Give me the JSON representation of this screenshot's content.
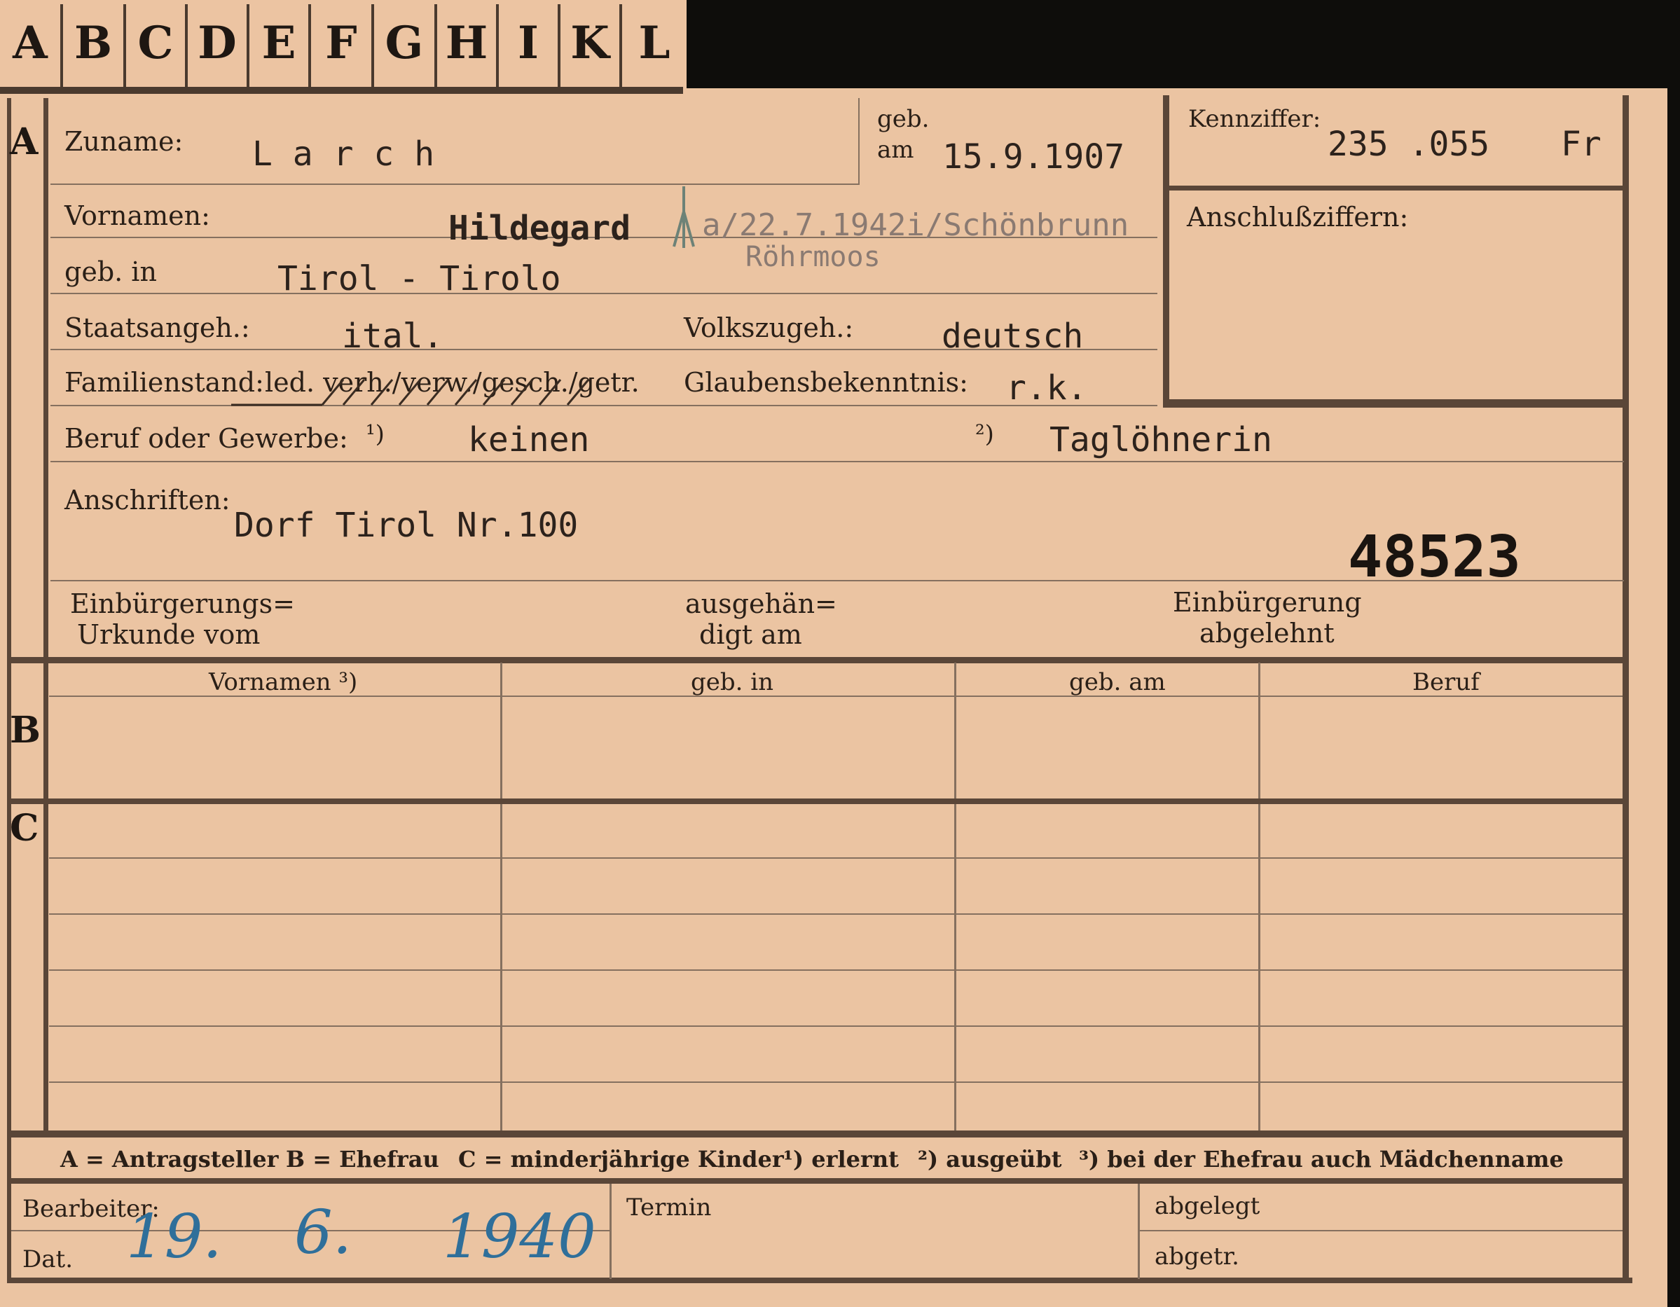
{
  "tabs": [
    "A",
    "B",
    "C",
    "D",
    "E",
    "F",
    "G",
    "H",
    "I",
    "K",
    "L"
  ],
  "sections": {
    "a": "A",
    "b": "B",
    "c": "C"
  },
  "fields": {
    "zuname_label": "Zuname:",
    "zuname_value": "L a r c h",
    "geb_label": "geb.",
    "am_label": "am",
    "geb_am_value": "15.9.1907",
    "kennziffer_label": "Kennziffer:",
    "kennziffer_value": "235 .055",
    "kennziffer_suffix": "Fr",
    "anschluss_label": "Anschlußziffern:",
    "vornamen_label": "Vornamen:",
    "vornamen_value": "Hildegard",
    "vornamen_note": "a/22.7.1942i/Schönbrunn",
    "vornamen_note2": "Röhrmoos",
    "geb_in_label": "geb. in",
    "geb_in_value": "Tirol - Tirolo",
    "staatsangeh_label": "Staatsangeh.:",
    "staatsangeh_value": "ital.",
    "volkszugeh_label": "Volkszugeh.:",
    "volkszugeh_value": "deutsch",
    "familienstand_label": "Familienstand:",
    "familienstand_options": "led. verh./verw./gesch./getr.",
    "glaubens_label": "Glaubensbekenntnis:",
    "glaubens_value": "r.k.",
    "beruf_label": "Beruf oder Gewerbe:",
    "beruf_mark1": "¹)",
    "beruf_value1": "keinen",
    "beruf_mark2": "²)",
    "beruf_value2": "Taglöhnerin",
    "anschriften_label": "Anschriften:",
    "anschriften_value": "Dorf Tirol  Nr.100",
    "stamp_number": "48523",
    "einb_urkunde_label1": "Einbürgerungs=",
    "einb_urkunde_label2": "Urkunde vom",
    "ausgeh_label1": "ausgehän=",
    "ausgeh_label2": "digt am",
    "einb_abgelehnt_label1": "Einbürgerung",
    "einb_abgelehnt_label2": "abgelehnt"
  },
  "table": {
    "headers": [
      "Vornamen ³)",
      "geb. in",
      "geb. am",
      "Beruf"
    ]
  },
  "legend": {
    "a": "A = Antragsteller",
    "b": "B = Ehefrau",
    "c": "C = minderjährige Kinder",
    "n1": "¹) erlernt",
    "n2": "²) ausgeübt",
    "n3": "³) bei der Ehefrau auch Mädchenname"
  },
  "footer": {
    "bearbeiter_label": "Bearbeiter:",
    "dat_label": "Dat.",
    "date_day": "19.",
    "date_month": "6.",
    "date_year": "1940",
    "termin_label": "Termin",
    "abgelegt_label": "abgelegt",
    "abgetr_label": "abgetr."
  }
}
